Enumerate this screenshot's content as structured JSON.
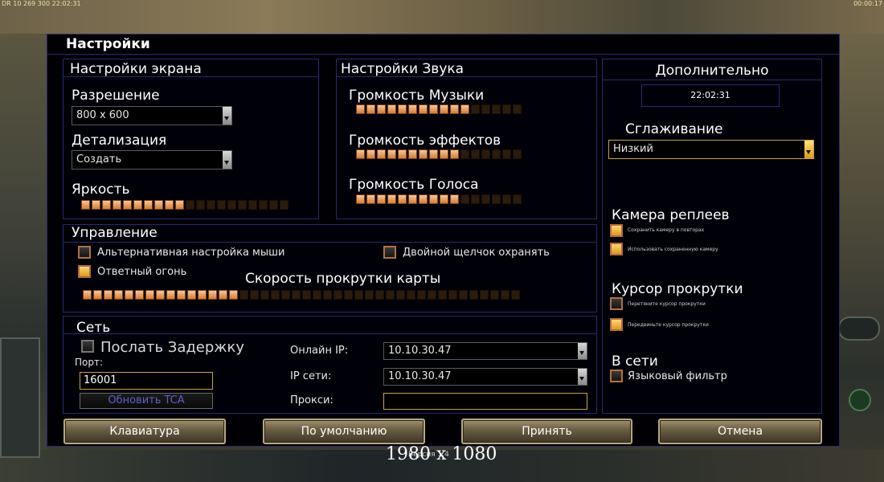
{
  "hud": {
    "top_left": "DR 10 269 300 22:02:31",
    "top_right": "00:00:17"
  },
  "dialog_title": "Настройки",
  "screen": {
    "title": "Настройки экрана",
    "resolution_label": "Разрешение",
    "resolution_value": "800 x 600",
    "detail_label": "Детализация",
    "detail_value": "Создать",
    "brightness_label": "Яркость",
    "brightness_level": 0.5
  },
  "sound": {
    "title": "Настройки Звука",
    "music_label": "Громкость Музыки",
    "music_level": 0.6875,
    "effects_label": "Громкость эффектов",
    "effects_level": 0.625,
    "voice_label": "Громкость Голоса",
    "voice_level": 0.625
  },
  "extra": {
    "title": "Дополнительно",
    "clock": "22:02:31",
    "antialias_label": "Сглаживание",
    "antialias_value": "Низкий",
    "replay_camera_title": "Камера реплеев",
    "replay_save_camera": "Сохранить камеру в повторах",
    "replay_use_saved_camera": "Использовать сохраненную камеру",
    "scroll_cursor_title": "Курсор прокрутки",
    "scroll_cursor_opt1": "Перетяните курсор прокрутки",
    "scroll_cursor_opt2": "Передвиньте курсор прокрутки",
    "online_title": "В сети",
    "language_filter": "Языковый фильтр"
  },
  "controls": {
    "title": "Управление",
    "alt_mouse": "Альтернативная настройка мыши",
    "double_click": "Двойной щелчок охранять",
    "retaliation": "Ответный огонь",
    "scroll_speed_label": "Скорость прокрутки карты",
    "scroll_speed_level": 0.3571
  },
  "network": {
    "title": "Сеть",
    "send_delay": "Послать Задержку",
    "port_label": "Порт:",
    "port_value": "16001",
    "update_tca": "Обновить TCA",
    "online_ip_label": "Онлайн IP:",
    "online_ip_value": "10.10.30.47",
    "lan_ip_label": "IP сети:",
    "lan_ip_value": "10.10.30.47",
    "proxy_label": "Прокси:",
    "proxy_value": ""
  },
  "buttons": {
    "keyboard": "Клавиатура",
    "defaults": "По умолчанию",
    "accept": "Принять",
    "cancel": "Отмена"
  },
  "footer": {
    "resolution": "1980 x 1080",
    "version": "Версия 1.4"
  }
}
